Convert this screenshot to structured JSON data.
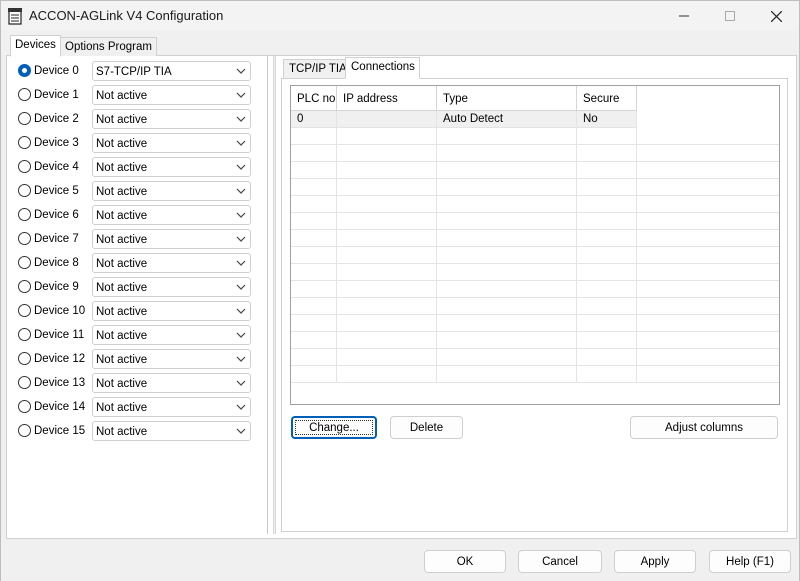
{
  "window": {
    "title": "ACCON-AGLink V4 Configuration"
  },
  "outer_tabs": [
    "Devices",
    "Options Program"
  ],
  "devices": [
    {
      "label": "Device 0",
      "value": "S7-TCP/IP TIA",
      "selected": true
    },
    {
      "label": "Device 1",
      "value": "Not active"
    },
    {
      "label": "Device 2",
      "value": "Not active"
    },
    {
      "label": "Device 3",
      "value": "Not active"
    },
    {
      "label": "Device 4",
      "value": "Not active"
    },
    {
      "label": "Device 5",
      "value": "Not active"
    },
    {
      "label": "Device 6",
      "value": "Not active"
    },
    {
      "label": "Device 7",
      "value": "Not active"
    },
    {
      "label": "Device 8",
      "value": "Not active"
    },
    {
      "label": "Device 9",
      "value": "Not active"
    },
    {
      "label": "Device 10",
      "value": "Not active"
    },
    {
      "label": "Device 11",
      "value": "Not active"
    },
    {
      "label": "Device 12",
      "value": "Not active"
    },
    {
      "label": "Device 13",
      "value": "Not active"
    },
    {
      "label": "Device 14",
      "value": "Not active"
    },
    {
      "label": "Device 15",
      "value": "Not active"
    }
  ],
  "inner_tabs": [
    "TCP/IP TIA",
    "Connections"
  ],
  "connections_table": {
    "columns": [
      "PLC no",
      "IP address",
      "Type",
      "Secure"
    ],
    "rows": [
      [
        "0",
        "",
        "Auto Detect",
        "No"
      ]
    ]
  },
  "buttons": {
    "change": "Change...",
    "delete": "Delete",
    "adjust_columns": "Adjust columns",
    "ok": "OK",
    "cancel": "Cancel",
    "apply": "Apply",
    "help": "Help (F1)"
  },
  "colors": {
    "accent": "#005fb8",
    "selected_row": "#f0f0f0"
  }
}
